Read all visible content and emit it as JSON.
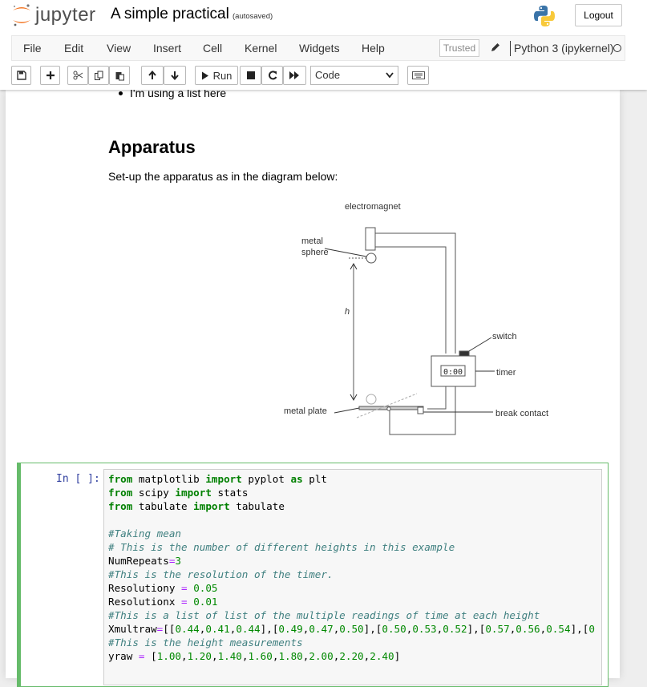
{
  "header": {
    "logo_text": "jupyter",
    "notebook_title": "A simple practical",
    "autosave_status": "(autosaved)",
    "logout_label": "Logout"
  },
  "menubar": {
    "items": [
      "File",
      "Edit",
      "View",
      "Insert",
      "Cell",
      "Kernel",
      "Widgets",
      "Help"
    ],
    "trusted_label": "Trusted",
    "kernel_name": "Python 3 (ipykernel)"
  },
  "toolbar": {
    "run_label": "Run",
    "cell_type_selected": "Code",
    "icons": [
      "save-icon",
      "plus-icon",
      "cut-icon",
      "copy-icon",
      "paste-icon",
      "arrow-up-icon",
      "arrow-down-icon",
      "play-icon",
      "stop-icon",
      "restart-icon",
      "fast-forward-icon",
      "keyboard-icon"
    ]
  },
  "markdown": {
    "list_item": "I'm using a list here",
    "heading": "Apparatus",
    "paragraph": "Set-up the apparatus as in the diagram below:"
  },
  "diagram": {
    "labels": {
      "electromagnet": "electromagnet",
      "metal_sphere_line1": "metal",
      "metal_sphere_line2": "sphere",
      "height": "h",
      "switch": "switch",
      "timer_display": "0:00",
      "timer": "timer",
      "metal_plate": "metal plate",
      "break_contact": "break contact"
    }
  },
  "code_cell": {
    "prompt": "In [ ]:",
    "lines": [
      "from matplotlib import pyplot as plt",
      "from scipy import stats",
      "from tabulate import tabulate",
      "",
      "#Taking mean",
      "# This is the number of different heights in this example",
      "NumRepeats=3",
      "#This is the resolution of the timer.",
      "Resolutiony = 0.05",
      "Resolutionx = 0.01",
      "#This is a list of list of the multiple readings of time at each height",
      "Xmultraw=[[0.44,0.41,0.44],[0.49,0.47,0.50],[0.50,0.53,0.52],[0.57,0.56,0.54],[0",
      "#This is the height measurements",
      "yraw = [1.00,1.20,1.40,1.60,1.80,2.00,2.20,2.40]"
    ]
  }
}
